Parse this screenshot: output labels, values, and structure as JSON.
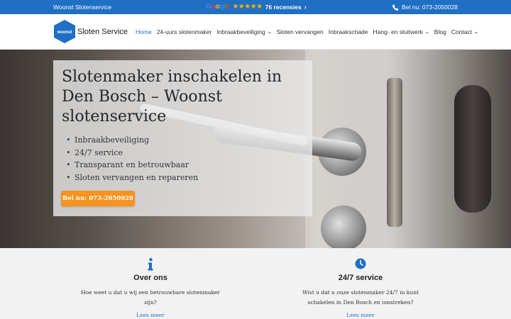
{
  "topbar": {
    "company": "Woonst Slotenservice",
    "google_word": "Google",
    "stars": "★★★★★",
    "reviews": "76 recensies",
    "phone": "Bel nu: 073-2050028"
  },
  "header": {
    "logo_badge": "woonst",
    "logo_text": "Sloten Service",
    "nav": [
      {
        "label": "Home"
      },
      {
        "label": "24-uurs slotenmaker"
      },
      {
        "label": "Inbraakbeveiliging"
      },
      {
        "label": "Sloten vervangen"
      },
      {
        "label": "Inbraakschade"
      },
      {
        "label": "Hang- en sluitwerk"
      },
      {
        "label": "Blog"
      },
      {
        "label": "Contact"
      }
    ]
  },
  "hero": {
    "title": "Slotenmaker inschakelen in Den Bosch – Woonst slotenservice",
    "bullets": [
      "Inbraakbeveiliging",
      "24/7 service",
      "Transparant en betrouwbaar",
      "Sloten vervangen en repareren"
    ],
    "cta": "Bel nu: 073-2050028"
  },
  "features": [
    {
      "icon": "info-icon",
      "title": "Over ons",
      "desc": "Hoe weet u dat u wij een betrouwbare slotenmaker zijn?",
      "link": "Lees meer"
    },
    {
      "icon": "clock-icon",
      "title": "24/7 service",
      "desc": "Wist u dat u onze slotenmaker 24/7 in kunt schakelen in Den Bosch en omstreken?",
      "link": "Lees meer"
    }
  ],
  "colors": {
    "brand_blue": "#1f6fc4",
    "cta_orange": "#f7931e",
    "star_yellow": "#f5b400"
  }
}
